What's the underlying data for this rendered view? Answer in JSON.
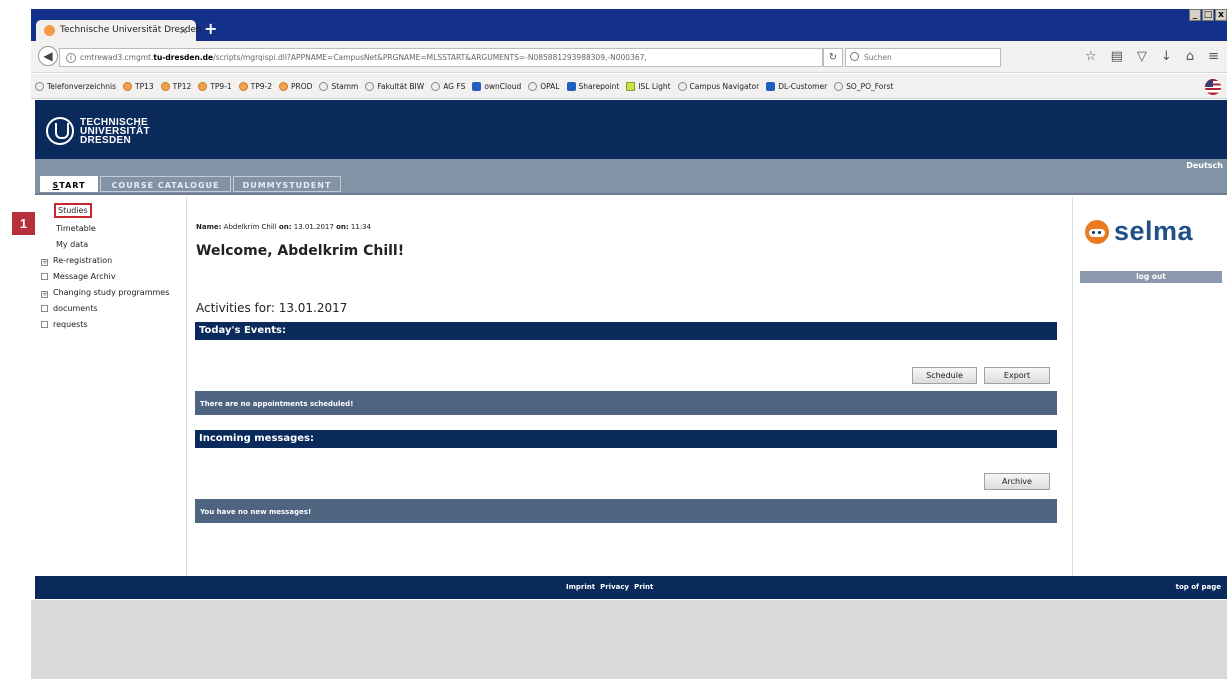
{
  "browser": {
    "tab_title": "Technische Universität Dresden",
    "tab_close": "×",
    "new_tab": "+",
    "window_controls": [
      "_",
      "□",
      "x"
    ],
    "url_prefix": "cmtrewad3.cmgmt.",
    "url_domain": "tu-dresden.de",
    "url_rest": "/scripts/mgrqispi.dll?APPNAME=CampusNet&PRGNAME=MLSSTART&ARGUMENTS=-N085881293988309,-N000367,",
    "search_placeholder": "Suchen",
    "bookmarks": [
      {
        "label": "Telefonverzeichnis",
        "icon": "tu-icon"
      },
      {
        "label": "TP13",
        "icon": "selma-icon"
      },
      {
        "label": "TP12",
        "icon": "selma-icon"
      },
      {
        "label": "TP9-1",
        "icon": "selma-icon"
      },
      {
        "label": "TP9-2",
        "icon": "selma-icon"
      },
      {
        "label": "PROD",
        "icon": "selma-icon"
      },
      {
        "label": "Stamm",
        "icon": "globe-icon"
      },
      {
        "label": "Fakultät BIW",
        "icon": "tu-icon"
      },
      {
        "label": "AG FS",
        "icon": "tu-icon"
      },
      {
        "label": "ownCloud",
        "icon": "cloud-icon"
      },
      {
        "label": "OPAL",
        "icon": "globe-icon"
      },
      {
        "label": "Sharepoint",
        "icon": "sharepoint-icon"
      },
      {
        "label": "ISL Light",
        "icon": "isl-icon"
      },
      {
        "label": "Campus Navigator",
        "icon": "tu-icon"
      },
      {
        "label": "DL-Customer",
        "icon": "dl-icon"
      },
      {
        "label": "SO_PO_Forst",
        "icon": "tu-icon"
      }
    ]
  },
  "site": {
    "logo_line1": "TECHNISCHE",
    "logo_line2": "UNIVERSITÄT",
    "logo_line3": "DRESDEN",
    "language": "Deutsch",
    "tabs": {
      "start_u": "S",
      "start_rest": "TART",
      "course": "COURSE CATALOGUE",
      "dummy": "DUMMYSTUDENT"
    }
  },
  "sidebar": {
    "badge": "1",
    "items": [
      {
        "label": "Studies"
      },
      {
        "label": "Timetable"
      },
      {
        "label": "My data"
      },
      {
        "label": "Re-registration",
        "marker": "+"
      },
      {
        "label": "Message Archiv",
        "marker": ""
      },
      {
        "label": "Changing study programmes",
        "marker": "+"
      },
      {
        "label": "documents",
        "marker": ""
      },
      {
        "label": "requests",
        "marker": ""
      }
    ]
  },
  "main": {
    "name_label": "Name:",
    "name_value": "Abdelkrim Chill",
    "on_label1": "on:",
    "date_value": "13.01.2017",
    "on_label2": "on:",
    "time_value": "11:34",
    "welcome": "Welcome, Abdelkrim Chill!",
    "activities": "Activities for: 13.01.2017",
    "events_header": "Today's Events:",
    "schedule_btn": "Schedule",
    "export_btn": "Export",
    "no_appointments": "There are no appointments scheduled!",
    "messages_header": "Incoming messages:",
    "archive_btn": "Archive",
    "no_messages": "You have no new messages!"
  },
  "right": {
    "brand": "selma",
    "logout": "log out"
  },
  "footer": {
    "imprint": "Imprint",
    "privacy": "Privacy",
    "print": "Print",
    "top": "top of page"
  }
}
